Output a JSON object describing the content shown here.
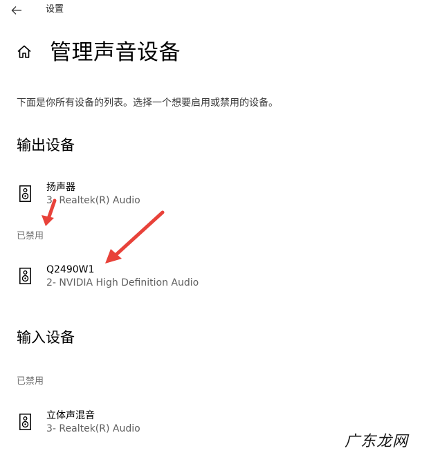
{
  "window": {
    "title": "设置"
  },
  "page": {
    "title": "管理声音设备",
    "description": "下面是你所有设备的列表。选择一个想要启用或禁用的设备。"
  },
  "output": {
    "heading": "输出设备",
    "devices": [
      {
        "name": "扬声器",
        "driver": "3- Realtek(R) Audio",
        "icon": "speaker-icon"
      }
    ],
    "disabled_label": "已禁用",
    "disabled_devices": [
      {
        "name": "Q2490W1",
        "driver": "2- NVIDIA High Definition Audio",
        "icon": "speaker-icon"
      }
    ]
  },
  "input": {
    "heading": "输入设备",
    "disabled_label": "已禁用",
    "disabled_devices": [
      {
        "name": "立体声混音",
        "driver": "3- Realtek(R) Audio",
        "icon": "speaker-icon"
      }
    ]
  },
  "watermark": "广东龙网",
  "colors": {
    "annotation_arrow": "#e8423a",
    "secondary_text": "#6e6e6e"
  }
}
